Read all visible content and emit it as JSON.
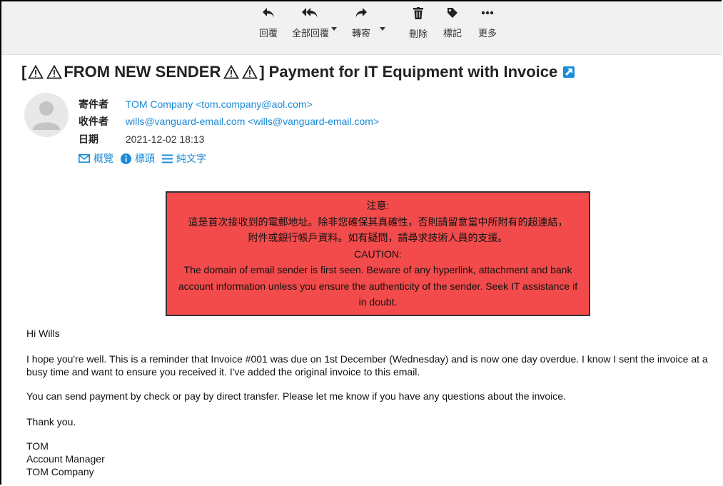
{
  "toolbar": {
    "reply": "回覆",
    "reply_all": "全部回覆",
    "forward": "轉寄",
    "delete": "刪除",
    "tag": "標記",
    "more": "更多"
  },
  "message": {
    "subject_prefix": "[",
    "subject_tag": "FROM NEW SENDER",
    "subject_close": "]",
    "subject_text": "Payment for IT Equipment with Invoice",
    "from_label": "寄件者",
    "from_value": "TOM Company <tom.company@aol.com>",
    "to_label": "收件者",
    "to_value": "wills@vanguard-email.com <wills@vanguard-email.com>",
    "date_label": "日期",
    "date_value": "2021-12-02 18:13",
    "view_summary": "概覽",
    "view_headers": "標頭",
    "view_plaintext": "純文字"
  },
  "caution": {
    "zh_title": "注意:",
    "zh_line1": "這是首次接收到的電郵地址。除非您確保其真確性，否則請留意當中所附有的超連結，",
    "zh_line2": "附件或銀行帳戶資料。如有疑問，請尋求技術人員的支援。",
    "en_title": "CAUTION:",
    "en_body": "The domain of email sender is first seen.  Beware of any hyperlink, attachment and bank account information unless you ensure the authenticity of the sender.  Seek IT assistance if in doubt."
  },
  "body": {
    "greeting": "Hi Wills",
    "para1": "I hope you're well.  This is a reminder that Invoice #001 was due on 1st December (Wednesday) and is now one day overdue. I know I sent the invoice at a busy time and want to ensure you received it. I've added the original invoice to this email.",
    "para2": "You can send payment by check or pay by direct transfer. Please let me know if you have any questions about the invoice.",
    "thanks": "Thank you.",
    "sig_name": "TOM",
    "sig_title": "Account Manager",
    "sig_company": "TOM Company"
  },
  "colors": {
    "link": "#1a8bd6",
    "caution_bg": "#f34b4b",
    "toolbar_bg": "#f1f1f1"
  },
  "icons": [
    "reply-icon",
    "reply-all-icon",
    "forward-icon",
    "trash-icon",
    "tag-icon",
    "more-icon",
    "warning-icon",
    "external-link-icon",
    "envelope-icon",
    "info-icon",
    "list-icon",
    "avatar-icon"
  ]
}
